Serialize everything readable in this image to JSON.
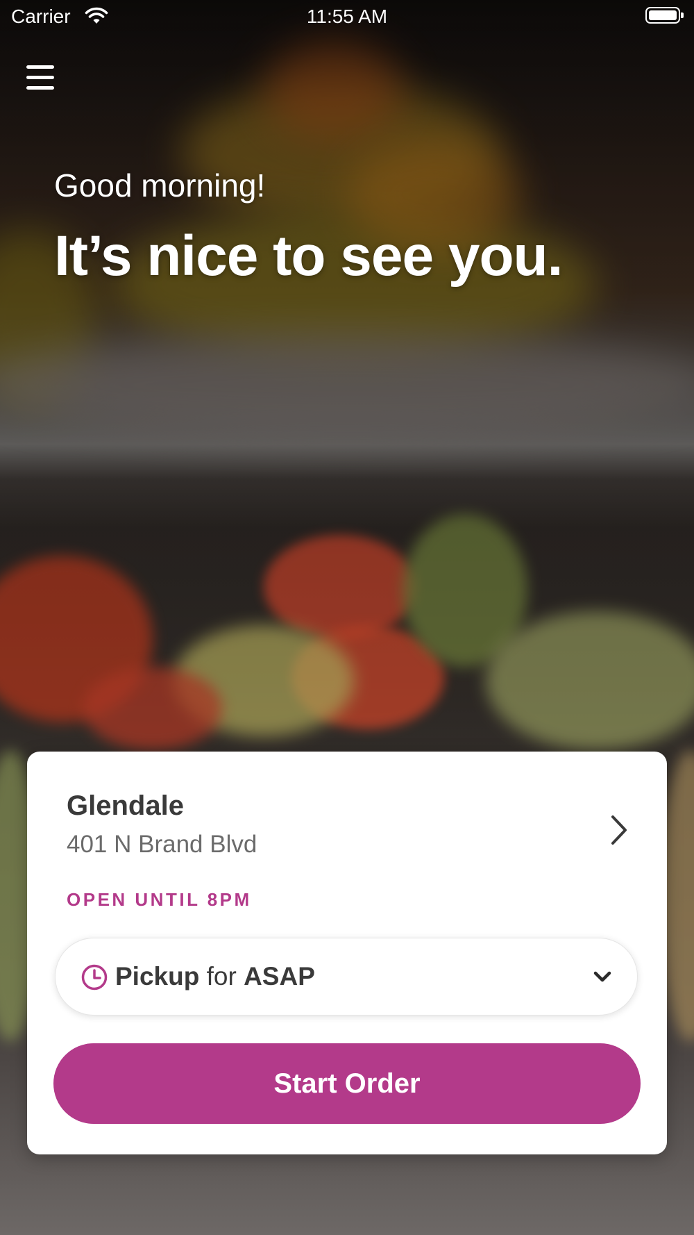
{
  "status_bar": {
    "carrier": "Carrier",
    "time": "11:55 AM"
  },
  "hero": {
    "greeting": "Good morning!",
    "headline": "It’s nice to see you."
  },
  "location": {
    "name": "Glendale",
    "address": "401 N Brand Blvd",
    "hours": "OPEN UNTIL 8PM"
  },
  "order_mode": {
    "mode": "Pickup",
    "connector": "for",
    "time": "ASAP"
  },
  "actions": {
    "start_label": "Start Order"
  },
  "colors": {
    "accent": "#b33a8a",
    "text_dark": "#3a3a3a",
    "text_muted": "#6b6b6b"
  },
  "icons": [
    "wifi-icon",
    "battery-icon",
    "menu-icon",
    "chevron-right-icon",
    "clock-icon",
    "chevron-down-icon"
  ]
}
